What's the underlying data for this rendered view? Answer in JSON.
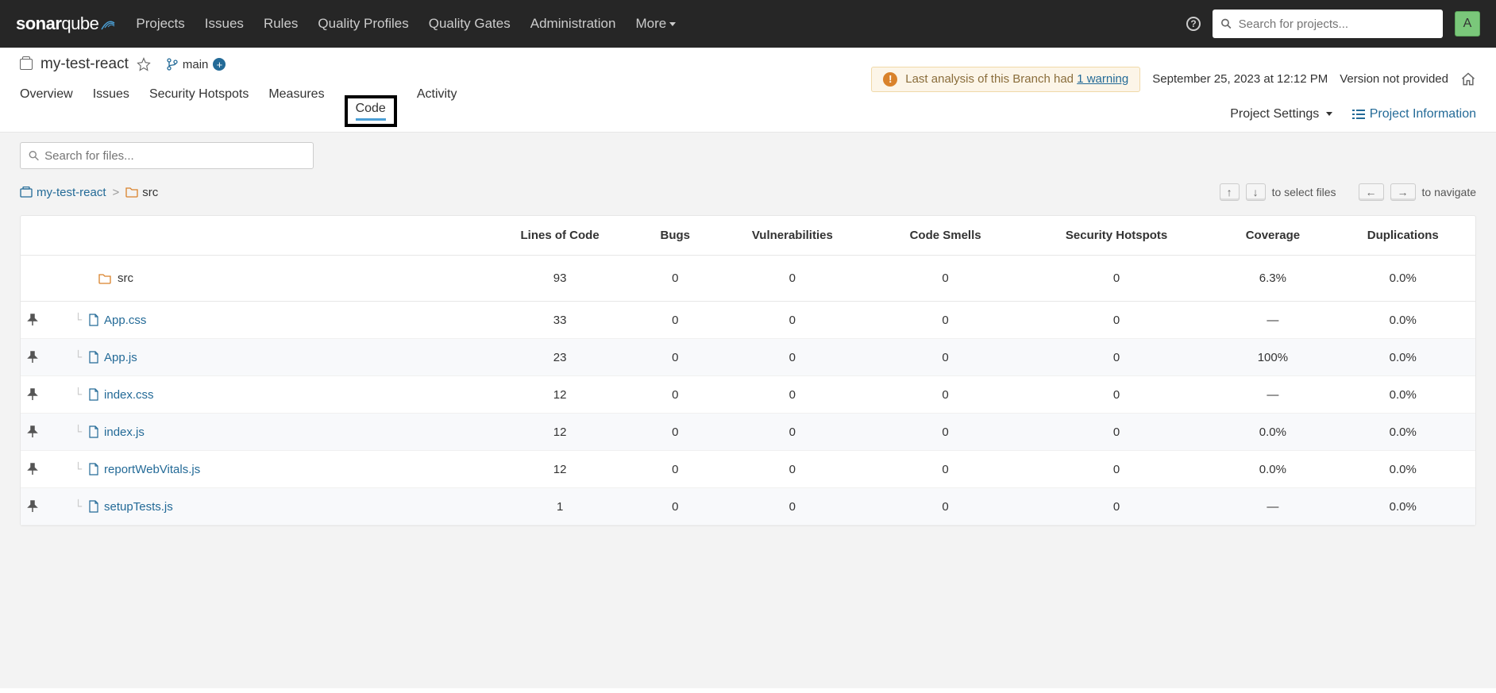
{
  "nav": {
    "links": [
      "Projects",
      "Issues",
      "Rules",
      "Quality Profiles",
      "Quality Gates",
      "Administration",
      "More"
    ],
    "search_placeholder": "Search for projects...",
    "avatar_initial": "A"
  },
  "project": {
    "name": "my-test-react",
    "branch": "main",
    "warning_prefix": "Last analysis of this Branch had ",
    "warning_link": "1 warning",
    "analysis_date": "September 25, 2023 at 12:12 PM",
    "version": "Version not provided"
  },
  "tabs": {
    "items": [
      "Overview",
      "Issues",
      "Security Hotspots",
      "Measures",
      "Code",
      "Activity"
    ],
    "settings": "Project Settings",
    "info": "Project Information"
  },
  "code": {
    "search_placeholder": "Search for files...",
    "breadcrumb_root": "my-test-react",
    "breadcrumb_current": "src",
    "hint_select": "to select files",
    "hint_navigate": "to navigate",
    "columns": [
      "",
      "",
      "Lines of Code",
      "Bugs",
      "Vulnerabilities",
      "Code Smells",
      "Security Hotspots",
      "Coverage",
      "Duplications"
    ],
    "summary": {
      "name": "src",
      "loc": "93",
      "bugs": "0",
      "vuln": "0",
      "smells": "0",
      "hotspots": "0",
      "coverage": "6.3%",
      "dup": "0.0%"
    },
    "files": [
      {
        "name": "App.css",
        "loc": "33",
        "bugs": "0",
        "vuln": "0",
        "smells": "0",
        "hotspots": "0",
        "coverage": "—",
        "dup": "0.0%"
      },
      {
        "name": "App.js",
        "loc": "23",
        "bugs": "0",
        "vuln": "0",
        "smells": "0",
        "hotspots": "0",
        "coverage": "100%",
        "dup": "0.0%"
      },
      {
        "name": "index.css",
        "loc": "12",
        "bugs": "0",
        "vuln": "0",
        "smells": "0",
        "hotspots": "0",
        "coverage": "—",
        "dup": "0.0%"
      },
      {
        "name": "index.js",
        "loc": "12",
        "bugs": "0",
        "vuln": "0",
        "smells": "0",
        "hotspots": "0",
        "coverage": "0.0%",
        "dup": "0.0%"
      },
      {
        "name": "reportWebVitals.js",
        "loc": "12",
        "bugs": "0",
        "vuln": "0",
        "smells": "0",
        "hotspots": "0",
        "coverage": "0.0%",
        "dup": "0.0%"
      },
      {
        "name": "setupTests.js",
        "loc": "1",
        "bugs": "0",
        "vuln": "0",
        "smells": "0",
        "hotspots": "0",
        "coverage": "—",
        "dup": "0.0%"
      }
    ]
  }
}
